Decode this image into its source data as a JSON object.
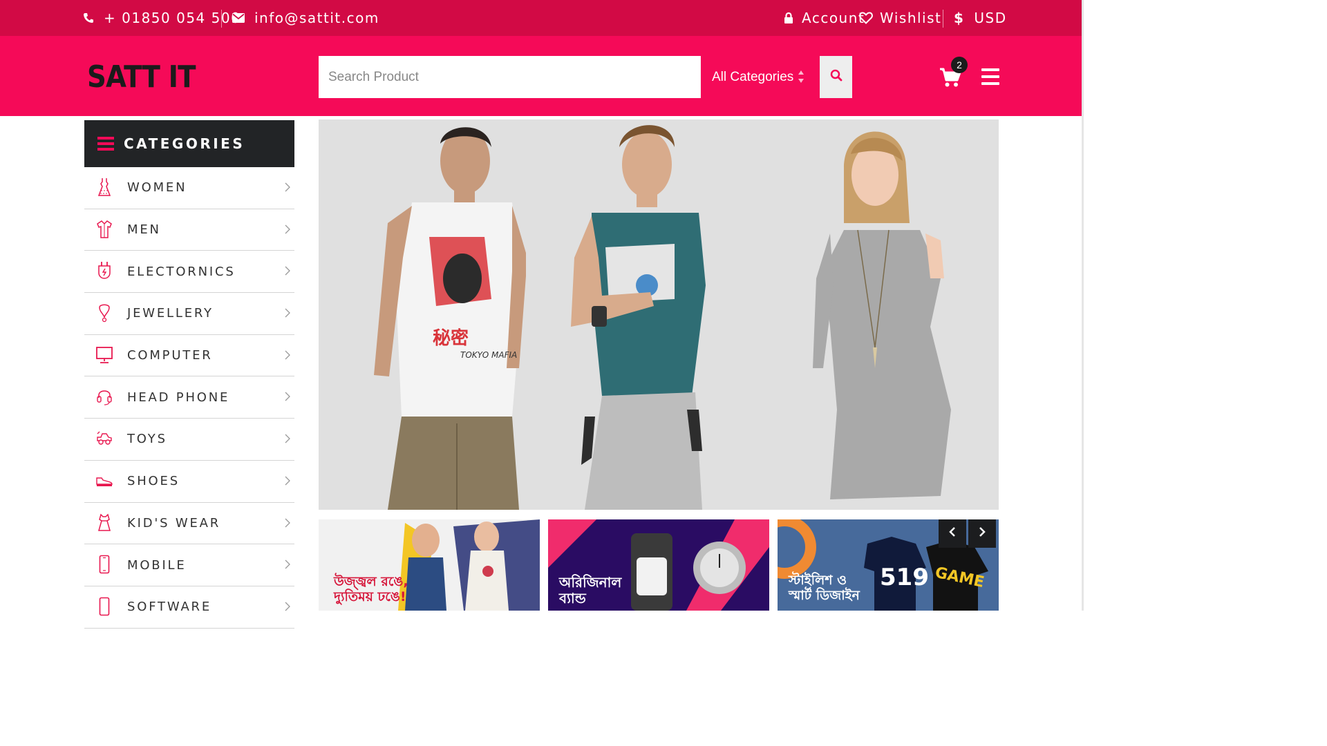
{
  "topbar": {
    "phone": "+ 01850 054 500",
    "email": "info@sattit.com",
    "account": "Account",
    "wishlist": "Wishlist",
    "currency": "USD"
  },
  "header": {
    "logo": "SATT IT",
    "search_placeholder": "Search Product",
    "category_select": "All Categories",
    "cart_count": "2"
  },
  "categories": {
    "title": "CATEGORIES",
    "items": [
      {
        "label": "WOMEN",
        "icon": "dress-icon"
      },
      {
        "label": "MEN",
        "icon": "shirt-icon"
      },
      {
        "label": "ELECTORNICS",
        "icon": "plug-icon"
      },
      {
        "label": "JEWELLERY",
        "icon": "pendant-icon"
      },
      {
        "label": "COMPUTER",
        "icon": "monitor-icon"
      },
      {
        "label": "HEAD PHONE",
        "icon": "headphone-icon"
      },
      {
        "label": "TOYS",
        "icon": "toy-car-icon"
      },
      {
        "label": "SHOES",
        "icon": "shoe-icon"
      },
      {
        "label": "KID'S WEAR",
        "icon": "kids-dress-icon"
      },
      {
        "label": "MOBILE",
        "icon": "mobile-icon"
      },
      {
        "label": "SOFTWARE",
        "icon": "software-icon"
      }
    ]
  },
  "hero": {
    "shirt_print_text": "TOKYO MAFIA"
  },
  "promos": [
    {
      "text_line1": "উজ্জ্বল রঙে,",
      "text_line2": "দ্যুতিময় ঢঙে!"
    },
    {
      "text_line1": "অরিজিনাল",
      "text_line2": "ব্যান্ড"
    },
    {
      "text_line1": "স্টাইলিশ ও",
      "text_line2": "স্মার্ট ডিজাইন",
      "shirt1": "519",
      "shirt2": "GAME"
    }
  ],
  "colors": {
    "topbar": "#d20a45",
    "header": "#f50a58",
    "dark": "#222426",
    "accent": "#f50a58"
  }
}
